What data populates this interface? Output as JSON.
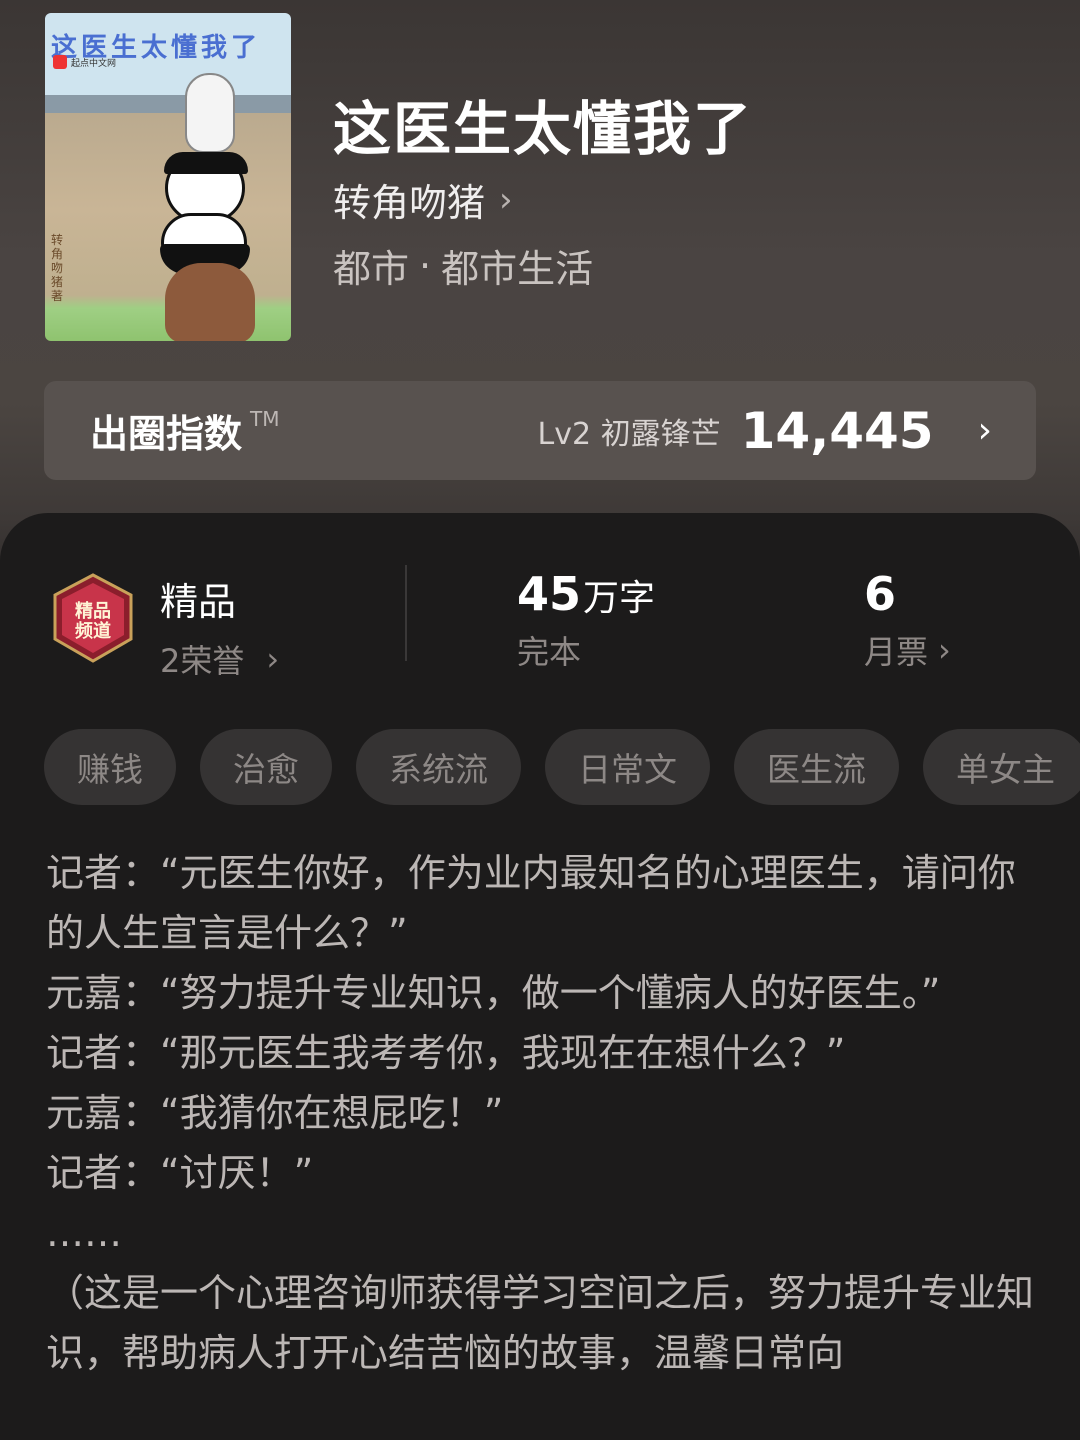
{
  "book": {
    "cover": {
      "title_art": "这医生太懂我了",
      "publisher": "起点中文网",
      "author_art": "转角吻猪著"
    },
    "title": "这医生太懂我了",
    "author": "转角吻猪",
    "genre": "都市",
    "subgenre": "都市生活",
    "genre_separator": "·"
  },
  "circle_index": {
    "label": "出圈指数",
    "tm": "TM",
    "level": "Lv2 初露锋芒",
    "score": "14,445"
  },
  "stats": {
    "quality": {
      "value": "精品",
      "label": "2荣誉",
      "badge_text": "精品频道"
    },
    "words": {
      "number": "45",
      "unit": "万字",
      "label": "完本"
    },
    "tickets": {
      "value": "6",
      "label": "月票"
    }
  },
  "tags": [
    "赚钱",
    "治愈",
    "系统流",
    "日常文",
    "医生流",
    "单女主"
  ],
  "synopsis": [
    "记者：“元医生你好，作为业内最知名的心理医生，请问你的人生宣言是什么？”",
    "元嘉：“努力提升专业知识，做一个懂病人的好医生。”",
    "记者：“那元医生我考考你，我现在在想什么？”",
    "元嘉：“我猜你在想屁吃！”",
    "记者：“讨厌！”",
    "……",
    "（这是一个心理咨询师获得学习空间之后，努力提升专业知识，帮助病人打开心结苦恼的故事，温馨日常向"
  ],
  "colors": {
    "background": "#1c1b1b",
    "header_bar": "#58524f",
    "tag_bg": "#353333",
    "tag_text": "#8d8886"
  }
}
